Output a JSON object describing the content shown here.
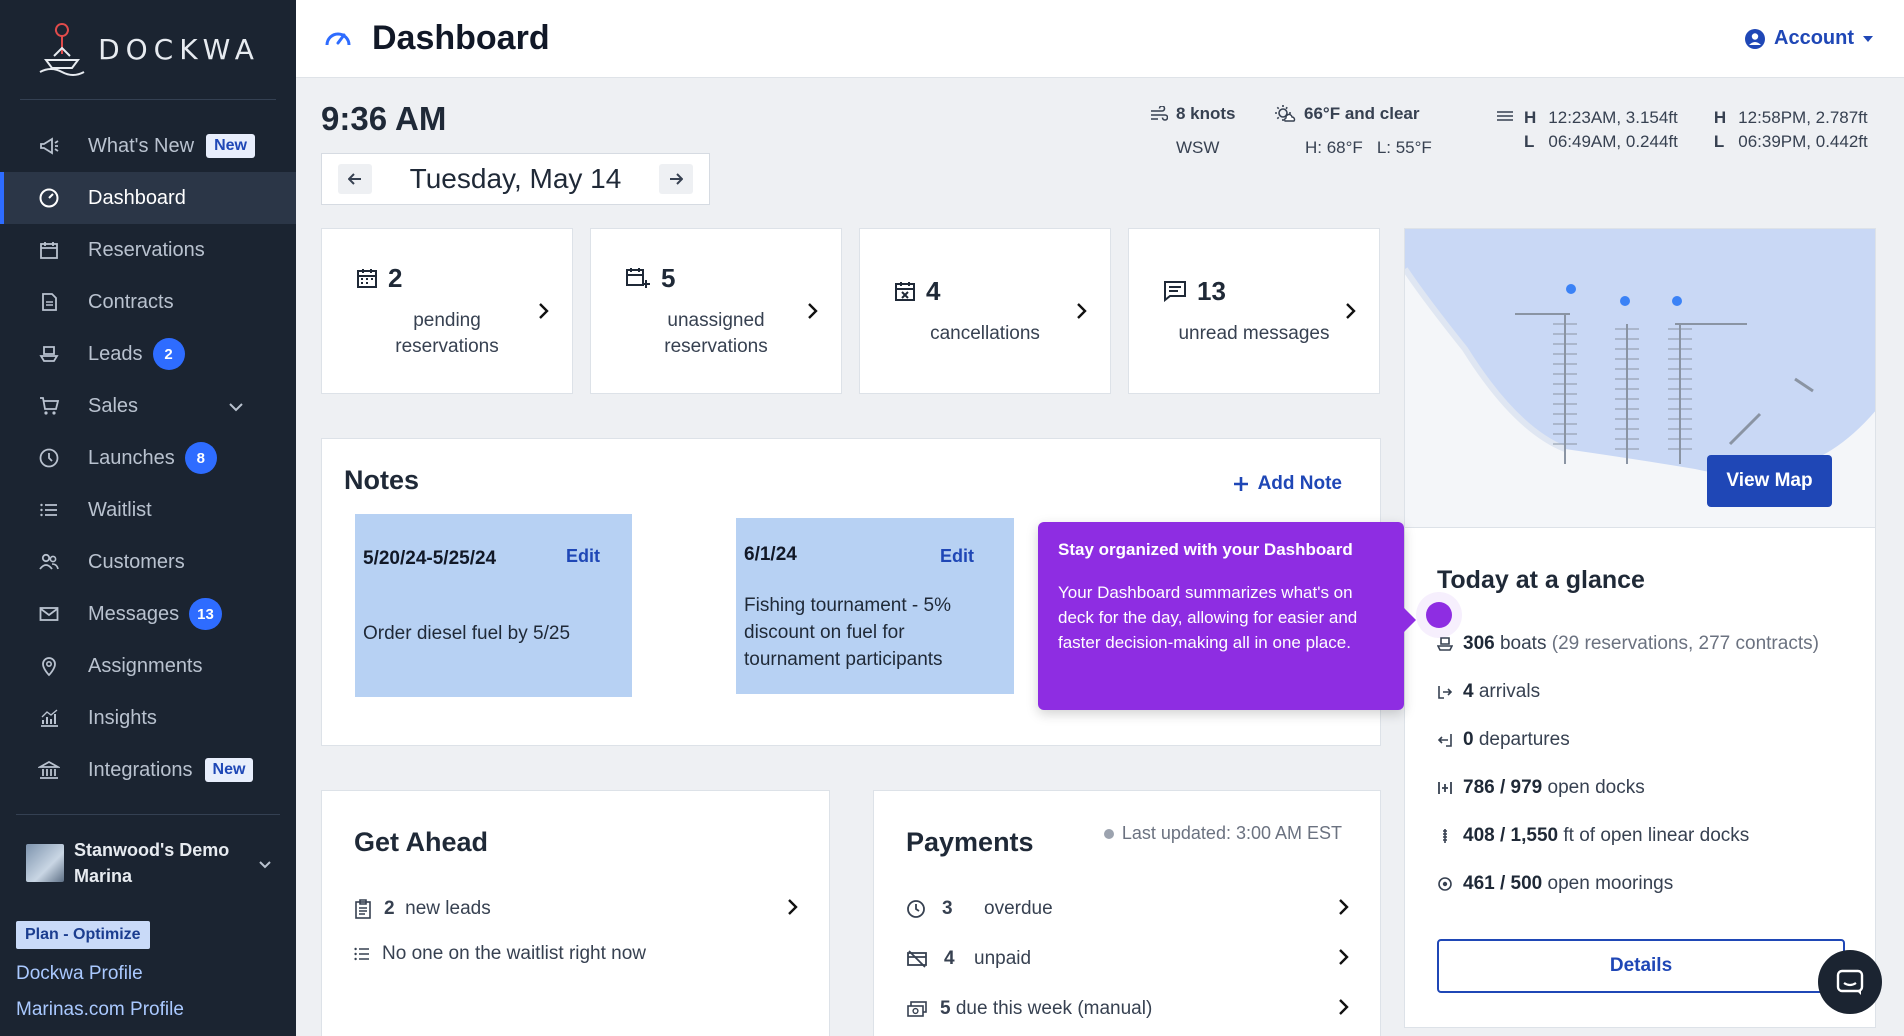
{
  "brand": {
    "name": "DOCKWA"
  },
  "sidebar": {
    "items": [
      {
        "label": "What's New",
        "icon": "megaphone-icon",
        "badge_new": "New"
      },
      {
        "label": "Dashboard",
        "icon": "dashboard-gauge-icon",
        "active": true
      },
      {
        "label": "Reservations",
        "icon": "calendar-icon"
      },
      {
        "label": "Contracts",
        "icon": "document-icon"
      },
      {
        "label": "Leads",
        "icon": "boat-icon",
        "badge": "2"
      },
      {
        "label": "Sales",
        "icon": "cart-icon",
        "expandable": true
      },
      {
        "label": "Launches",
        "icon": "clock-icon",
        "badge": "8"
      },
      {
        "label": "Waitlist",
        "icon": "list-icon"
      },
      {
        "label": "Customers",
        "icon": "people-icon"
      },
      {
        "label": "Messages",
        "icon": "envelope-icon",
        "badge": "13"
      },
      {
        "label": "Assignments",
        "icon": "pin-icon"
      },
      {
        "label": "Insights",
        "icon": "chart-icon"
      },
      {
        "label": "Integrations",
        "icon": "bank-icon",
        "badge_new": "New"
      }
    ],
    "marina": {
      "name_line1": "Stanwood's Demo",
      "name_line2": "Marina"
    },
    "plan": "Plan - Optimize",
    "links": [
      "Dockwa Profile",
      "Marinas.com Profile"
    ]
  },
  "header": {
    "title": "Dashboard",
    "account_label": "Account"
  },
  "today": {
    "time": "9:36 AM",
    "date": "Tuesday, May 14",
    "wind": {
      "speed": "8 knots",
      "direction": "WSW"
    },
    "weather": {
      "summary": "66°F and clear",
      "high": "H: 68°F",
      "low": "L: 55°F"
    },
    "tides": {
      "col1": {
        "h_label": "H",
        "h_value": "12:23AM, 3.154ft",
        "l_label": "L",
        "l_value": "06:49AM, 0.244ft"
      },
      "col2": {
        "h_label": "H",
        "h_value": "12:58PM, 2.787ft",
        "l_label": "L",
        "l_value": "06:39PM, 0.442ft"
      }
    }
  },
  "stats": [
    {
      "value": "2",
      "label_line1": "pending",
      "label_line2": "reservations",
      "icon": "calendar-icon"
    },
    {
      "value": "5",
      "label_line1": "unassigned",
      "label_line2": "reservations",
      "icon": "calendar-plus-icon"
    },
    {
      "value": "4",
      "label_line1": "cancellations",
      "label_line2": "",
      "icon": "calendar-x-icon"
    },
    {
      "value": "13",
      "label_line1": "unread messages",
      "label_line2": "",
      "icon": "message-icon"
    }
  ],
  "map": {
    "button_label": "View Map"
  },
  "glance": {
    "title": "Today at a glance",
    "boats": {
      "value": "306",
      "unit": "boats",
      "detail": "(29 reservations, 277 contracts)"
    },
    "arrivals": {
      "value": "4",
      "unit": "arrivals"
    },
    "departures": {
      "value": "0",
      "unit": "departures"
    },
    "docks": {
      "value": "786 / 979",
      "unit": "open docks"
    },
    "linear": {
      "value": "408 / 1,550",
      "unit": "ft of open linear docks"
    },
    "moorings": {
      "value": "461 / 500",
      "unit": "open moorings"
    },
    "details_label": "Details"
  },
  "notes": {
    "title": "Notes",
    "add_label": "Add Note",
    "items": [
      {
        "date": "5/20/24-5/25/24",
        "edit": "Edit",
        "text": "Order diesel fuel by 5/25"
      },
      {
        "date": "6/1/24",
        "edit": "Edit",
        "text": "Fishing tournament - 5% discount on fuel for tournament participants"
      }
    ]
  },
  "tooltip": {
    "title": "Stay organized with your Dashboard",
    "body": "Your Dashboard summarizes what's on deck for the day, allowing for easier and faster decision-making all in one place."
  },
  "get_ahead": {
    "title": "Get Ahead",
    "leads": {
      "value": "2",
      "label": "new leads"
    },
    "waitlist": "No one on the waitlist right now"
  },
  "payments": {
    "title": "Payments",
    "updated": "Last updated: 3:00 AM EST",
    "rows": [
      {
        "value": "3",
        "label": "overdue",
        "icon": "clock-icon"
      },
      {
        "value": "4",
        "label": "unpaid",
        "icon": "no-card-icon"
      },
      {
        "value": "5",
        "label": "due this week (manual)",
        "icon": "cash-icon"
      }
    ]
  },
  "colors": {
    "sidebar": "#1b2431",
    "accent": "#1f47b6",
    "badge": "#2e6cff",
    "tooltip": "#8e2de2",
    "note": "#b7d1f3"
  }
}
